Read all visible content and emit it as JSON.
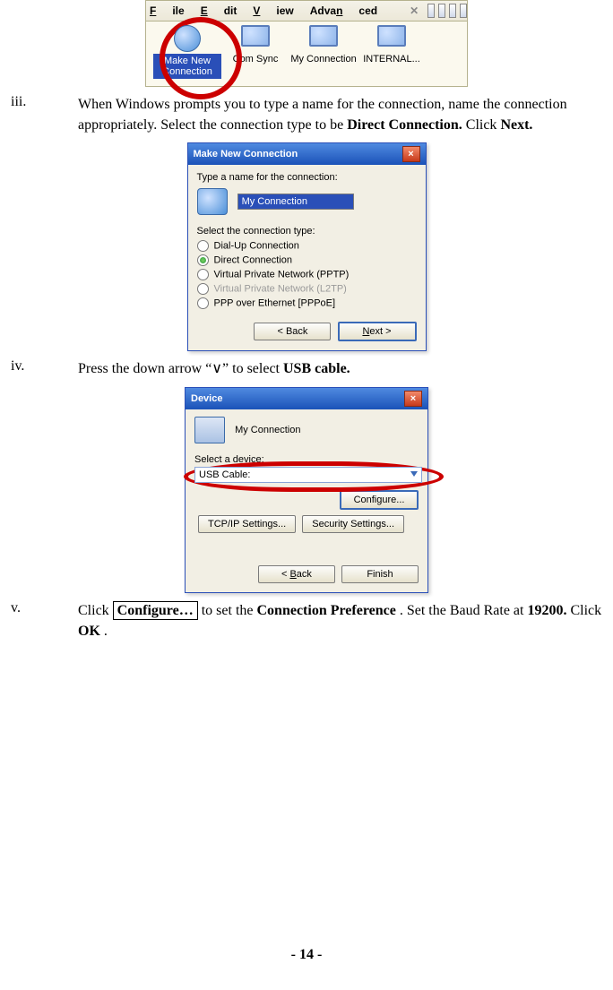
{
  "ss1": {
    "menu": {
      "file": "File",
      "edit": "Edit",
      "view": "View",
      "advanced": "Advanced"
    },
    "icons": {
      "make_new": "Make New Connection",
      "com_sync": "Com Sync",
      "my_connection": "My Connection",
      "internal": "INTERNAL..."
    }
  },
  "steps": {
    "iii": {
      "marker": "iii.",
      "text_a": "When Windows prompts you to type a name for the connection, name the connection appropriately. Select the connection type to be ",
      "bold_a": "Direct Connection.",
      "text_b": " Click ",
      "bold_b": "Next."
    },
    "iv": {
      "marker": "iv.",
      "text_a": "Press the down arrow ",
      "arrow_quote": "“∨”",
      "text_b": " to select ",
      "bold_a": "USB cable."
    },
    "v": {
      "marker": "v.",
      "text_a": "Click ",
      "btn_label": "Configure…",
      "text_b": "  to set the ",
      "bold_a": "Connection Preference",
      "text_c": ". Set the Baud Rate at ",
      "bold_b": "19200.",
      "text_d": "  Click ",
      "bold_c": "OK",
      "text_e": "."
    }
  },
  "dlg_new": {
    "title": "Make New Connection",
    "prompt_name": "Type a name for the connection:",
    "field_value": "My Connection",
    "prompt_type": "Select the connection type:",
    "opts": {
      "dialup": "Dial-Up Connection",
      "direct": "Direct Connection",
      "pptp": "Virtual Private Network (PPTP)",
      "l2tp": "Virtual Private Network (L2TP)",
      "pppoe": "PPP over Ethernet [PPPoE]"
    },
    "btn_back": "< Back",
    "btn_next": "Next >"
  },
  "dlg_device": {
    "title": "Device",
    "header_value": "My Connection",
    "prompt": "Select a device:",
    "combo_value": "USB Cable:",
    "btn_configure": "Configure...",
    "btn_tcp": "TCP/IP Settings...",
    "btn_sec": "Security Settings...",
    "btn_back": "< Back",
    "btn_finish": "Finish"
  },
  "page_number": "- 14 -"
}
